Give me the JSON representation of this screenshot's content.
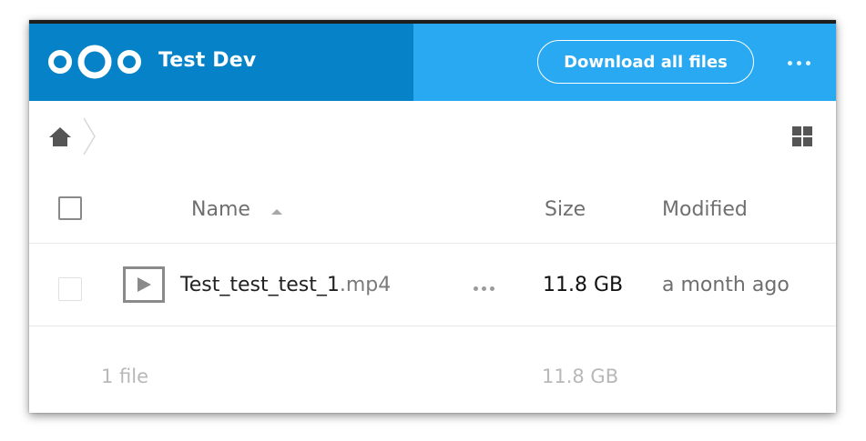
{
  "header": {
    "app_title": "Test Dev",
    "download_label": "Download all files",
    "more_icon": "more-horizontal-icon",
    "logo_icon": "nextcloud-logo",
    "colors": {
      "primary_dark": "#0682c9",
      "primary": "#29a9f1"
    }
  },
  "breadcrumb": {
    "home_icon": "home-icon",
    "separator_icon": "chevron-right-icon"
  },
  "view_toggle_icon": "grid-view-icon",
  "table": {
    "headers": {
      "name": "Name",
      "size": "Size",
      "modified": "Modified"
    },
    "rows": [
      {
        "icon": "video-file-icon",
        "name_base": "Test_test_test_1",
        "name_ext": ".mp4",
        "size": "11.8 GB",
        "modified": "a month ago"
      }
    ]
  },
  "summary": {
    "count": "1 file",
    "total_size": "11.8 GB"
  }
}
